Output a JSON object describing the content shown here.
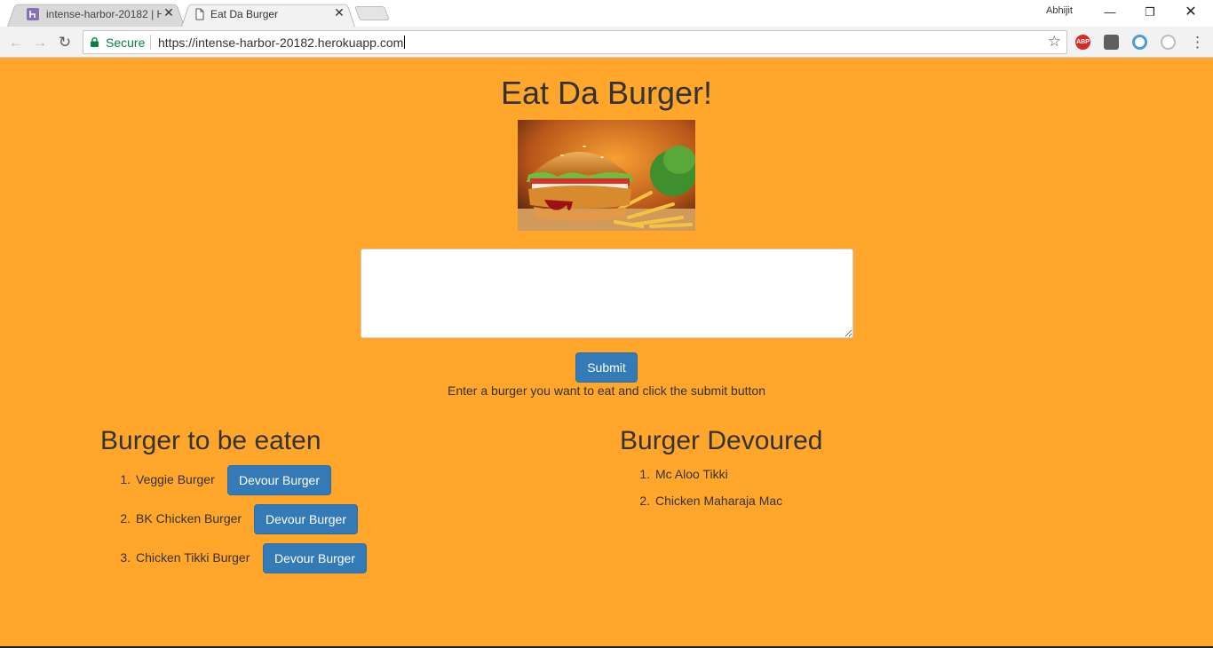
{
  "browser": {
    "tabs": [
      {
        "title": "intense-harbor-20182 | H",
        "favicon": "heroku-icon",
        "active": false
      },
      {
        "title": "Eat Da Burger",
        "favicon": "document-icon",
        "active": true
      }
    ],
    "profile_name": "Abhijit",
    "secure_label": "Secure",
    "url": "https://intense-harbor-20182.herokuapp.com",
    "extensions": [
      {
        "name": "adblock-icon",
        "label": "ABP",
        "color": "#d62a2a"
      },
      {
        "name": "extension-dark-icon",
        "label": "",
        "color": "#5f5f5f"
      },
      {
        "name": "chrome-circle-icon",
        "label": "",
        "color": "#4a9bdf"
      },
      {
        "name": "extension-gray-icon",
        "label": "",
        "color": "#bdbdbd"
      }
    ]
  },
  "page": {
    "title": "Eat Da Burger!",
    "image_name": "burger-image",
    "textarea_value": "",
    "submit_label": "Submit",
    "hint": "Enter a burger you want to eat and click the submit button",
    "to_eat": {
      "title": "Burger to be eaten",
      "items": [
        {
          "num": "1.",
          "name": "Veggie Burger",
          "button": "Devour Burger"
        },
        {
          "num": "2.",
          "name": "BK Chicken Burger",
          "button": "Devour Burger"
        },
        {
          "num": "3.",
          "name": "Chicken Tikki Burger",
          "button": "Devour Burger"
        }
      ]
    },
    "devoured": {
      "title": "Burger Devoured",
      "items": [
        {
          "num": "1.",
          "name": "Mc Aloo Tikki"
        },
        {
          "num": "2.",
          "name": "Chicken Maharaja Mac"
        }
      ]
    }
  },
  "colors": {
    "page_background": "#ffa62b",
    "button_primary": "#337ab7",
    "secure_green": "#0b8043"
  }
}
